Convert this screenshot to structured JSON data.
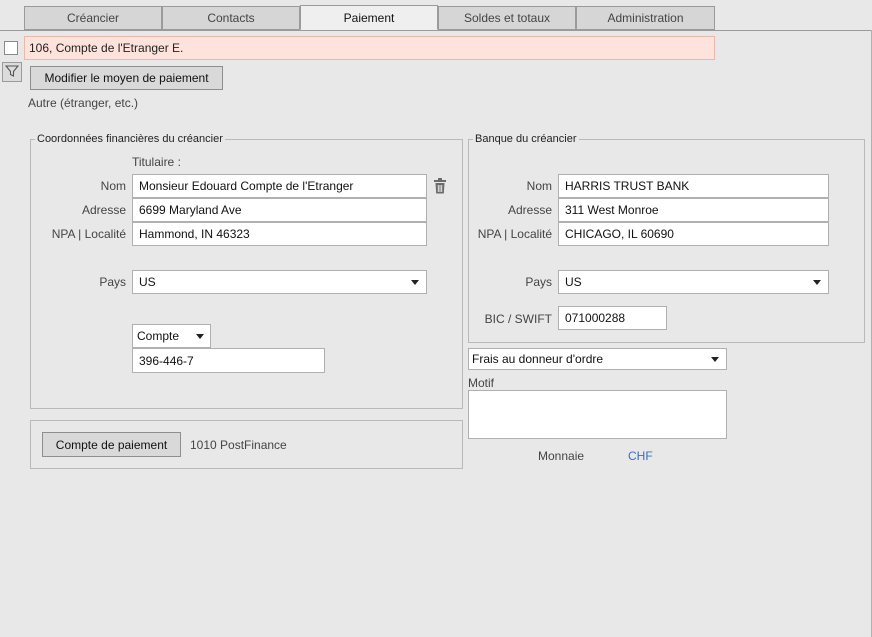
{
  "tabs": [
    "Créancier",
    "Contacts",
    "Paiement",
    "Soldes et totaux",
    "Administration"
  ],
  "active_tab": "Paiement",
  "record": {
    "title": "106, Compte de l'Etranger E."
  },
  "modify_button": "Modifier le moyen de paiement",
  "payment_type": "Autre (étranger, etc.)",
  "financial": {
    "title": "Coordonnées financières du créancier",
    "holder_label": "Titulaire :",
    "name_label": "Nom",
    "name": "Monsieur Edouard Compte de l'Etranger",
    "address_label": "Adresse",
    "address": "6699 Maryland Ave",
    "npa_label": "NPA | Localité",
    "npa": "Hammond, IN 46323",
    "country_label": "Pays",
    "country": "US",
    "account_type": "Compte",
    "account_number": "396-446-7"
  },
  "bank": {
    "title": "Banque du créancier",
    "name_label": "Nom",
    "name": "HARRIS TRUST BANK",
    "address_label": "Adresse",
    "address": "311 West Monroe",
    "npa_label": "NPA | Localité",
    "npa": "CHICAGO, IL 60690",
    "country_label": "Pays",
    "country": "US",
    "bic_label": "BIC / SWIFT",
    "bic": "071000288"
  },
  "fees": "Frais au donneur d'ordre",
  "motif_label": "Motif",
  "motif": "",
  "currency_label": "Monnaie",
  "currency": "CHF",
  "payment_account_button": "Compte de paiement",
  "payment_account": "1010 PostFinance",
  "colors": {
    "record_bg": "#fde3db",
    "currency_link": "#3a6bc6"
  },
  "icons": {
    "trash": "trash-icon",
    "filter": "filter-icon",
    "dropdown": "chevron-down-icon"
  }
}
